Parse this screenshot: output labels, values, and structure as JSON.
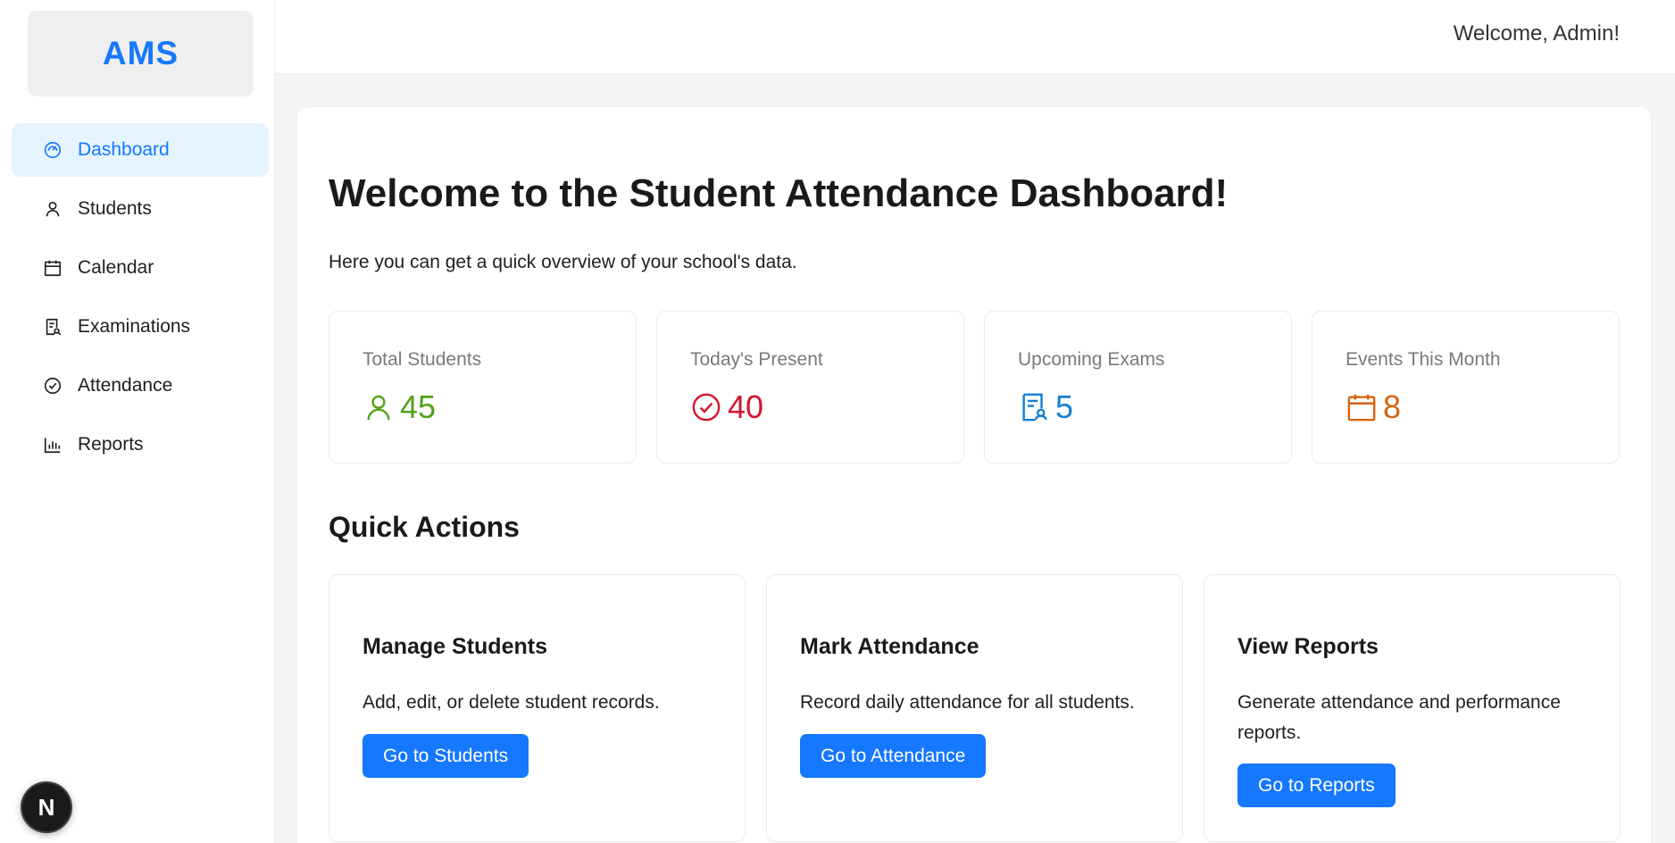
{
  "app": {
    "logo": "AMS"
  },
  "sidebar": {
    "items": [
      {
        "label": "Dashboard",
        "icon": "dashboard-icon",
        "active": true
      },
      {
        "label": "Students",
        "icon": "user-icon",
        "active": false
      },
      {
        "label": "Calendar",
        "icon": "calendar-icon",
        "active": false
      },
      {
        "label": "Examinations",
        "icon": "exam-icon",
        "active": false
      },
      {
        "label": "Attendance",
        "icon": "check-circle-icon",
        "active": false
      },
      {
        "label": "Reports",
        "icon": "bar-chart-icon",
        "active": false
      }
    ]
  },
  "header": {
    "welcome": "Welcome, Admin!"
  },
  "main": {
    "title": "Welcome to the Student Attendance Dashboard!",
    "subtitle": "Here you can get a quick overview of your school's data.",
    "stats": [
      {
        "label": "Total Students",
        "value": "45",
        "icon": "user-icon",
        "color": "#52a11a"
      },
      {
        "label": "Today's Present",
        "value": "40",
        "icon": "check-circle-icon",
        "color": "#d3152f"
      },
      {
        "label": "Upcoming Exams",
        "value": "5",
        "icon": "exam-icon",
        "color": "#1380d6"
      },
      {
        "label": "Events This Month",
        "value": "8",
        "icon": "calendar-icon",
        "color": "#d9630f"
      }
    ],
    "quick_actions_title": "Quick Actions",
    "actions": [
      {
        "title": "Manage Students",
        "description": "Add, edit, or delete student records.",
        "button": "Go to Students"
      },
      {
        "title": "Mark Attendance",
        "description": "Record daily attendance for all students.",
        "button": "Go to Attendance"
      },
      {
        "title": "View Reports",
        "description": "Generate attendance and performance reports.",
        "button": "Go to Reports"
      }
    ]
  },
  "colors": {
    "accent": "#1677ff",
    "active_bg": "#e6f4ff"
  },
  "badge": {
    "letter": "N"
  }
}
